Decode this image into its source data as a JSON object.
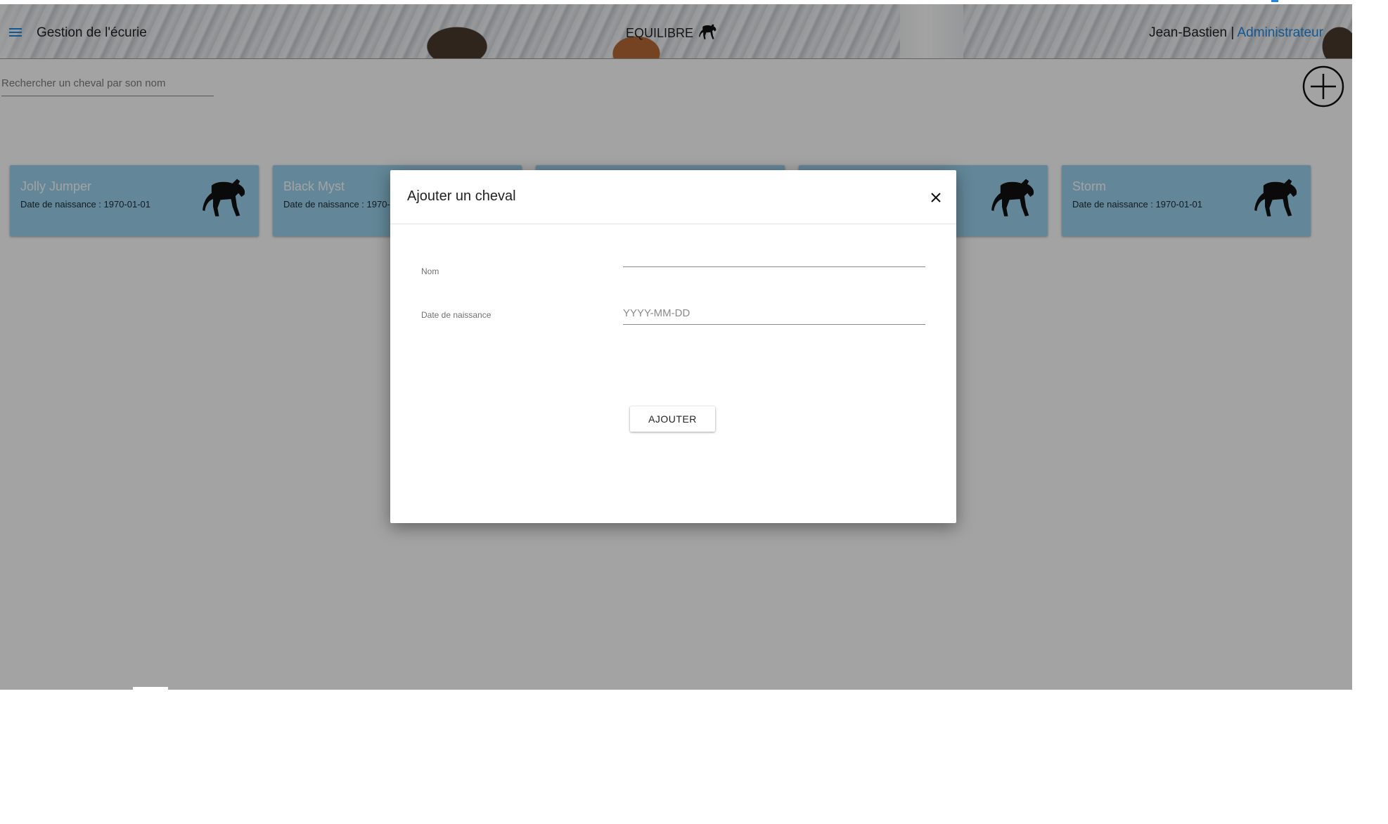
{
  "header": {
    "app_title": "Gestion de l'écurie",
    "brand": "EQUILIBRE",
    "user_name": "Jean-Bastien",
    "separator": " | ",
    "user_role": "Administrateur"
  },
  "search": {
    "placeholder": "Rechercher un cheval par son nom"
  },
  "horses": [
    {
      "name": "Jolly Jumper",
      "dob": "Date de naissance : 1970-01-01"
    },
    {
      "name": "Black Myst",
      "dob": "Date de naissance : 1970-01-01"
    },
    {
      "name": "",
      "dob": ""
    },
    {
      "name": "",
      "dob": ""
    },
    {
      "name": "Storm",
      "dob": "Date de naissance : 1970-01-01"
    }
  ],
  "modal": {
    "title": "Ajouter un cheval",
    "fields": {
      "name_label": "Nom",
      "name_value": "",
      "dob_label": "Date de naissance",
      "dob_placeholder": "YYYY-MM-DD",
      "dob_value": ""
    },
    "submit_label": "AJOUTER"
  },
  "colors": {
    "accent": "#1e88e5",
    "card_background": "#9bd3ee",
    "overlay": "rgba(0,0,0,0.36)"
  },
  "icons": [
    "menu-icon",
    "horse-icon",
    "add-circle-icon",
    "close-icon"
  ]
}
